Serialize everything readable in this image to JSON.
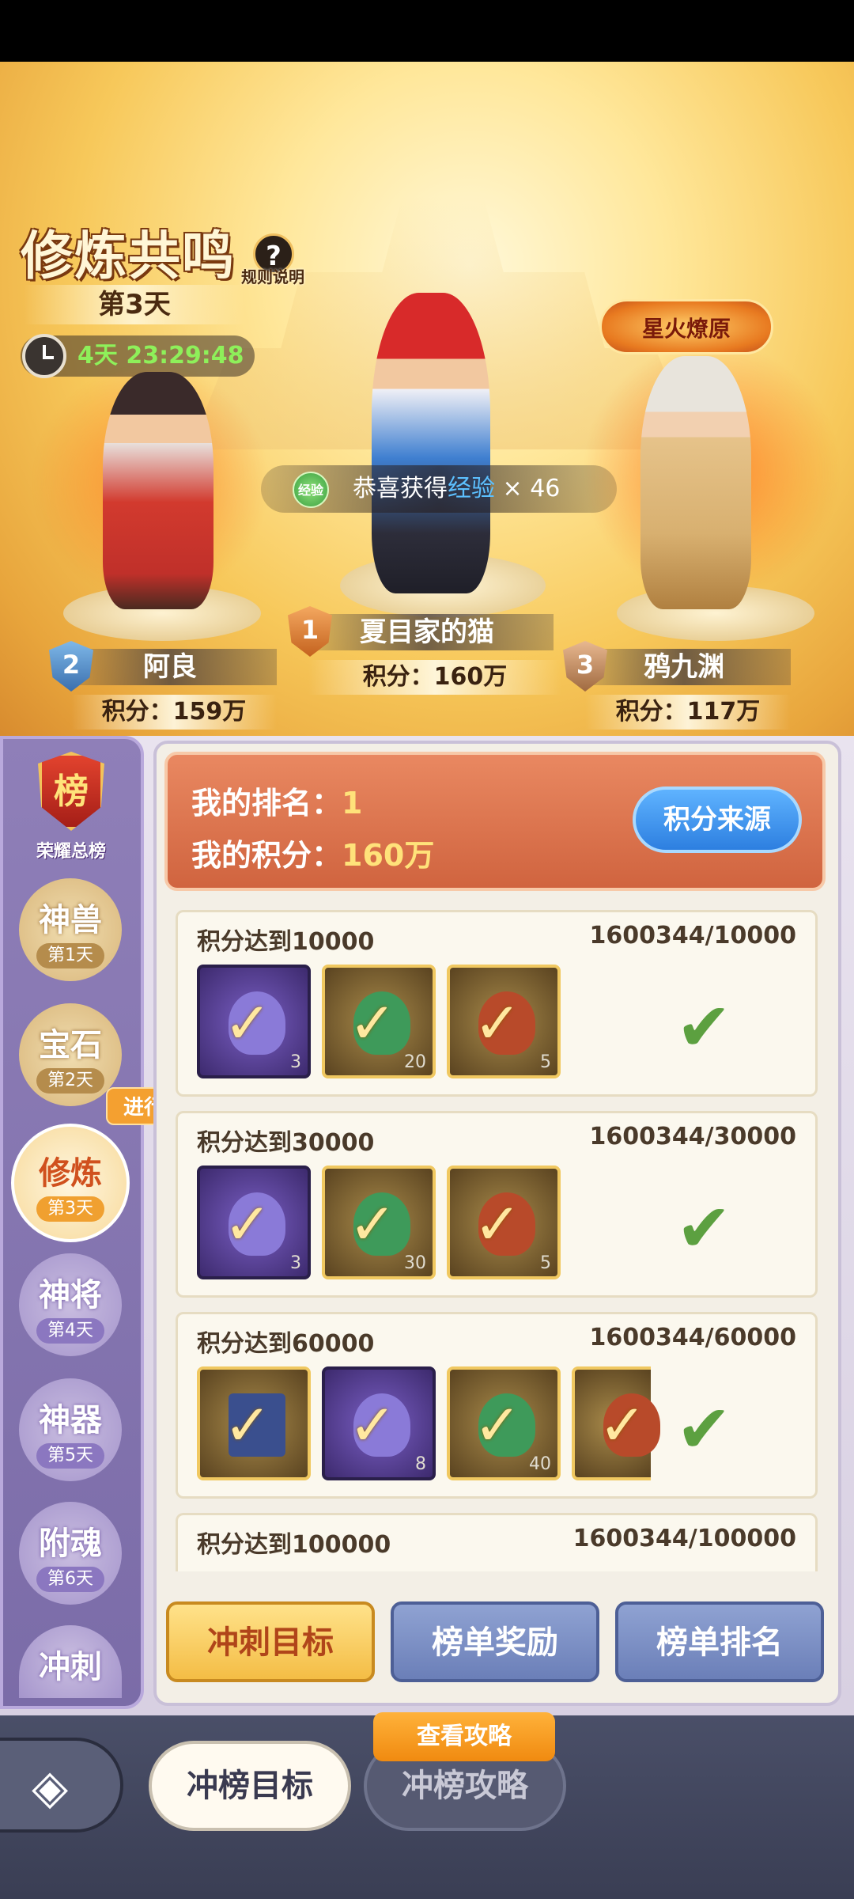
{
  "header": {
    "title": "修炼共鸣",
    "help_label": "规则说明",
    "day_label": "第3天",
    "timer": "4天 23:29:48",
    "exp_notice_prefix": "恭喜获得",
    "exp_notice_item": "经验",
    "exp_notice_count": "× 46",
    "exp_badge": "经验",
    "fire_badge": "星火燎原"
  },
  "podium": [
    {
      "rank": "1",
      "name": "夏目家的猫",
      "score": "积分：160万"
    },
    {
      "rank": "2",
      "name": "阿良",
      "score": "积分：159万"
    },
    {
      "rank": "3",
      "name": "鸦九渊",
      "score": "积分：117万"
    }
  ],
  "sidebar": {
    "crest_char": "榜",
    "crest_label": "荣耀总榜",
    "progress_tag": "进行中",
    "items": [
      {
        "label": "神兽",
        "day": "第1天"
      },
      {
        "label": "宝石",
        "day": "第2天"
      },
      {
        "label": "修炼",
        "day": "第3天"
      },
      {
        "label": "神将",
        "day": "第4天"
      },
      {
        "label": "神器",
        "day": "第5天"
      },
      {
        "label": "附魂",
        "day": "第6天"
      },
      {
        "label": "冲刺",
        "day": ""
      }
    ]
  },
  "my_rank": {
    "rank_label": "我的排名：",
    "rank_value": "1",
    "score_label": "我的积分：",
    "score_value": "160万",
    "source_button": "积分来源"
  },
  "tiers": [
    {
      "title": "积分达到10000",
      "progress": "1600344/10000",
      "items": [
        {
          "qty": "3"
        },
        {
          "qty": "20"
        },
        {
          "qty": "5"
        }
      ]
    },
    {
      "title": "积分达到30000",
      "progress": "1600344/30000",
      "items": [
        {
          "qty": "3"
        },
        {
          "qty": "30"
        },
        {
          "qty": "5"
        }
      ]
    },
    {
      "title": "积分达到60000",
      "progress": "1600344/60000",
      "items": [
        {
          "qty": ""
        },
        {
          "qty": "8"
        },
        {
          "qty": "40"
        },
        {
          "qty": ""
        }
      ]
    },
    {
      "title": "积分达到100000",
      "progress": "1600344/100000",
      "items": []
    }
  ],
  "tabs": {
    "sprint_target": "冲刺目标",
    "rank_reward": "榜单奖励",
    "rank_list": "榜单排名"
  },
  "footer": {
    "tab_target": "冲榜目标",
    "tab_guide": "冲榜攻略",
    "guide_tag": "查看攻略"
  },
  "colors": {
    "accent_orange": "#d0643f",
    "check_green": "#5ca040",
    "timer_green": "#8ef05a"
  }
}
